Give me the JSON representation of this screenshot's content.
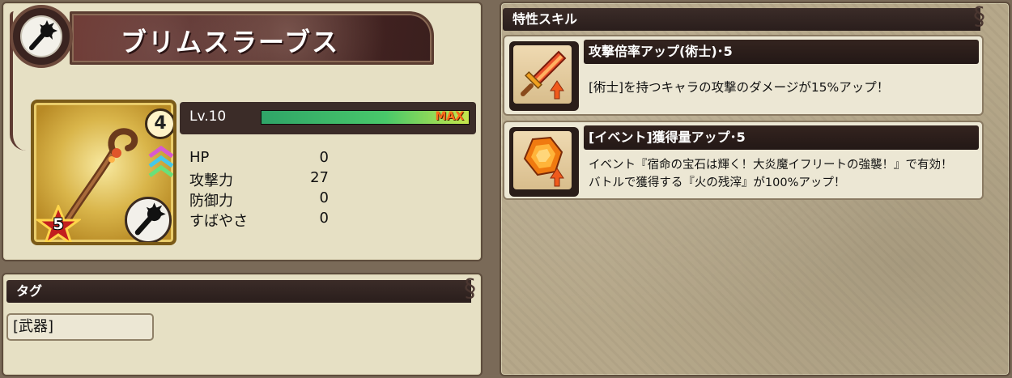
{
  "item": {
    "name": "ブリムスラーブス",
    "type_icon": "mace-icon",
    "card": {
      "level_badge": "4",
      "star_rank": "5",
      "rank_icon": "triple-chevron-icon",
      "weapon_icon": "mace-icon",
      "art_icon": "staff-icon"
    },
    "level": {
      "label": "Lv.10",
      "exp_fraction": 1.0,
      "max_label": "MAX"
    },
    "stats": [
      {
        "label": "HP",
        "value": "0"
      },
      {
        "label": "攻撃力",
        "value": "27"
      },
      {
        "label": "防御力",
        "value": "0"
      },
      {
        "label": "すばやさ",
        "value": "0"
      }
    ]
  },
  "tags": {
    "header": "タグ",
    "items": [
      "[武器]"
    ]
  },
  "skills": {
    "header": "特性スキル",
    "list": [
      {
        "icon": "sword-up-icon",
        "title": "攻撃倍率アップ(術士)･5",
        "description_lines": [
          "[術士]を持つキャラの攻撃のダメージが15%アップ！"
        ]
      },
      {
        "icon": "gem-up-icon",
        "title": "[イベント]獲得量アップ･5",
        "description_lines": [
          "イベント『宿命の宝石は輝く！大炎魔イフリートの強襲！』で有効！",
          "バトルで獲得する『火の残滓』が100%アップ！"
        ]
      }
    ]
  },
  "colors": {
    "panel_bg": "#e6e0c4",
    "header_bg": "#2a1e1c",
    "exp_bar": "#49c86a",
    "max_text": "#ff6a1a"
  }
}
